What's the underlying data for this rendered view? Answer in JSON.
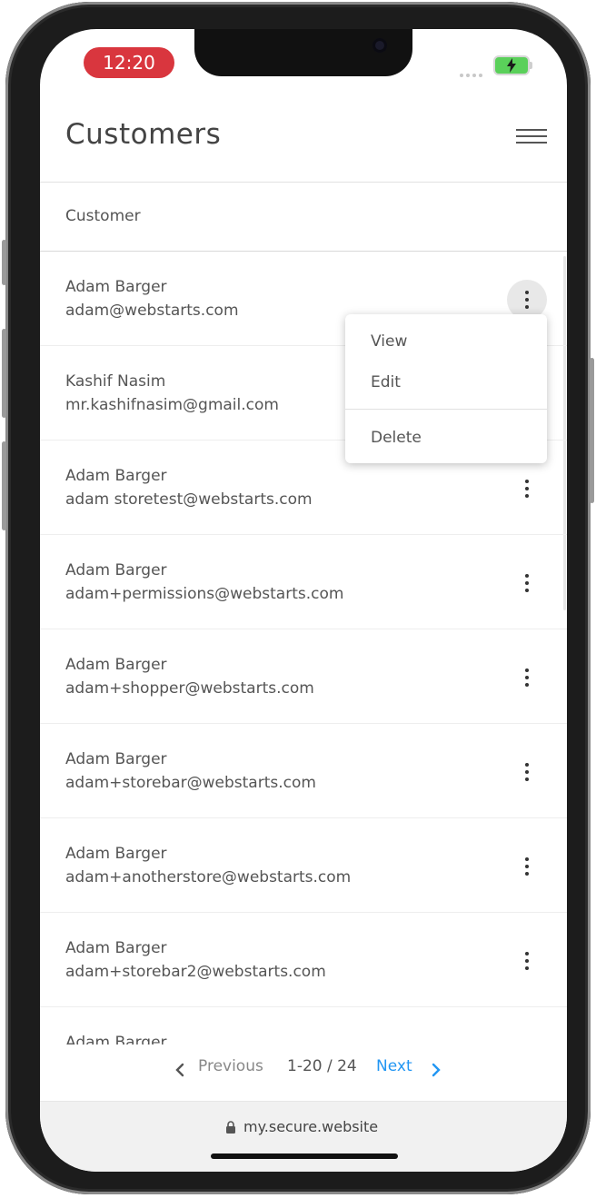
{
  "status_bar": {
    "time": "12:20"
  },
  "header": {
    "title": "Customers"
  },
  "table": {
    "column_header": "Customer"
  },
  "customers": [
    {
      "name": "Adam Barger",
      "email": "adam@webstarts.com"
    },
    {
      "name": "Kashif Nasim",
      "email": "mr.kashifnasim@gmail.com"
    },
    {
      "name": "Adam Barger",
      "email": "adam storetest@webstarts.com"
    },
    {
      "name": "Adam Barger",
      "email": "adam+permissions@webstarts.com"
    },
    {
      "name": "Adam Barger",
      "email": "adam+shopper@webstarts.com"
    },
    {
      "name": "Adam Barger",
      "email": "adam+storebar@webstarts.com"
    },
    {
      "name": "Adam Barger",
      "email": "adam+anotherstore@webstarts.com"
    },
    {
      "name": "Adam Barger",
      "email": "adam+storebar2@webstarts.com"
    },
    {
      "name": "Adam Barger",
      "email": ""
    }
  ],
  "context_menu": {
    "view": "View",
    "edit": "Edit",
    "delete": "Delete"
  },
  "pagination": {
    "previous": "Previous",
    "range": "1-20 / 24",
    "next": "Next"
  },
  "browser": {
    "url": "my.secure.website"
  },
  "colors": {
    "accent": "#2196f3",
    "time_pill": "#d9363e",
    "battery": "#5ad05a"
  }
}
